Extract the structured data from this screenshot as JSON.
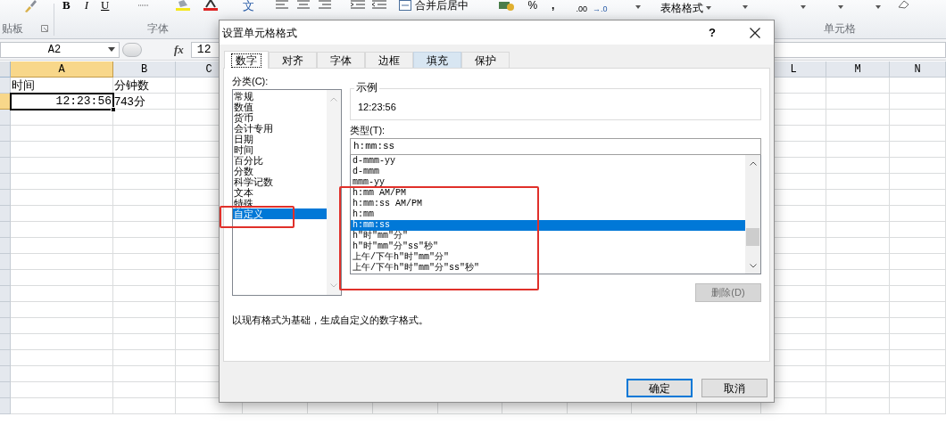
{
  "ribbon": {
    "bold": "B",
    "italic": "I",
    "underline": "U",
    "phonetic": "文",
    "merge": "合并后居中",
    "percent": "%",
    "comma": ",",
    "decimals_more": ".00",
    "decimals_less": "→.0",
    "format_as_table": "表格格式",
    "group_labels": [
      "贴板",
      "字体",
      "单元格"
    ]
  },
  "formula_bar": {
    "name_box": "A2",
    "function_label": "fx",
    "value": "12"
  },
  "sheet": {
    "columns": [
      {
        "label": "A",
        "selected": true
      },
      {
        "label": "B",
        "selected": false
      },
      {
        "label": "C",
        "selected": false
      },
      {
        "label": "L",
        "selected": false
      },
      {
        "label": "M",
        "selected": false
      },
      {
        "label": "N",
        "selected": false
      }
    ],
    "rows": [
      {
        "selected": false,
        "cells": [
          "时间",
          "分钟数"
        ]
      },
      {
        "selected": true,
        "cells": [
          "12:23:56",
          "743分"
        ]
      }
    ]
  },
  "dialog": {
    "title": "设置单元格格式",
    "help": "?",
    "tabs": [
      {
        "label": "数字",
        "selected": true,
        "hovered": false
      },
      {
        "label": "对齐",
        "selected": false,
        "hovered": false
      },
      {
        "label": "字体",
        "selected": false,
        "hovered": false
      },
      {
        "label": "边框",
        "selected": false,
        "hovered": false
      },
      {
        "label": "填充",
        "selected": false,
        "hovered": true
      },
      {
        "label": "保护",
        "selected": false,
        "hovered": false
      }
    ],
    "category_label": "分类(C):",
    "categories": [
      {
        "label": "常规",
        "selected": false
      },
      {
        "label": "数值",
        "selected": false
      },
      {
        "label": "货币",
        "selected": false
      },
      {
        "label": "会计专用",
        "selected": false
      },
      {
        "label": "日期",
        "selected": false
      },
      {
        "label": "时间",
        "selected": false
      },
      {
        "label": "百分比",
        "selected": false
      },
      {
        "label": "分数",
        "selected": false
      },
      {
        "label": "科学记数",
        "selected": false
      },
      {
        "label": "文本",
        "selected": false
      },
      {
        "label": "特殊",
        "selected": false
      },
      {
        "label": "自定义",
        "selected": true
      }
    ],
    "sample_label": "示例",
    "sample_value": "12:23:56",
    "type_label": "类型(T):",
    "type_value": "h:mm:ss",
    "types": [
      {
        "label": "d-mmm-yy",
        "selected": false
      },
      {
        "label": "d-mmm",
        "selected": false
      },
      {
        "label": "mmm-yy",
        "selected": false
      },
      {
        "label": "h:mm AM/PM",
        "selected": false
      },
      {
        "label": "h:mm:ss AM/PM",
        "selected": false
      },
      {
        "label": "h:mm",
        "selected": false
      },
      {
        "label": "h:mm:ss",
        "selected": true
      },
      {
        "label": "h\"时\"mm\"分\"",
        "selected": false
      },
      {
        "label": "h\"时\"mm\"分\"ss\"秒\"",
        "selected": false
      },
      {
        "label": "上午/下午h\"时\"mm\"分\"",
        "selected": false
      },
      {
        "label": "上午/下午h\"时\"mm\"分\"ss\"秒\"",
        "selected": false
      }
    ],
    "delete_button": {
      "label": "删除(D)",
      "disabled": true
    },
    "description": "以现有格式为基础，生成自定义的数字格式。",
    "buttons": [
      {
        "label": "确定",
        "default": true
      },
      {
        "label": "取消",
        "default": false
      }
    ]
  }
}
